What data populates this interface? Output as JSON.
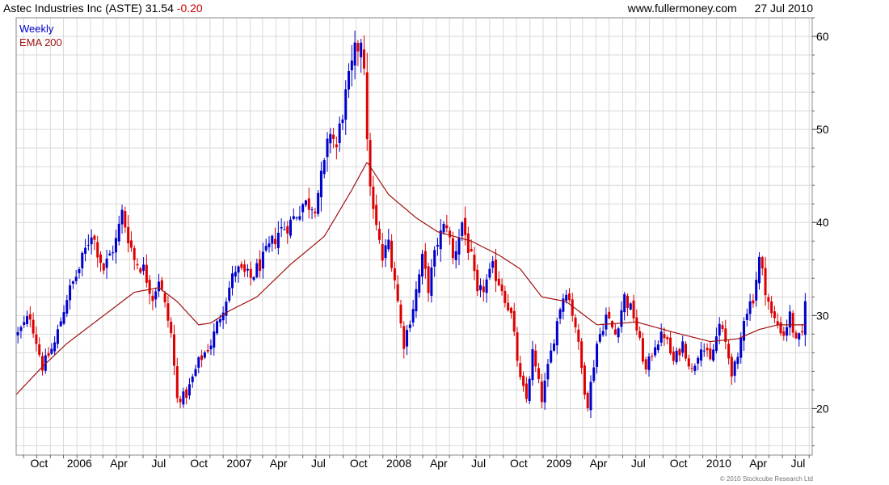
{
  "header": {
    "name": "Astec Industries Inc",
    "ticker": "(ASTE)",
    "last": "31.54",
    "change": "-0.20",
    "website": "www.fullermoney.com",
    "date": "27 Jul 2010"
  },
  "copyright": "© 2010 Stockcube Research Ltd",
  "colors": {
    "up": "#0000cc",
    "down": "#dd0000",
    "ema": "#a01010",
    "grid": "#d9d9d9"
  },
  "chart_data": {
    "type": "candlestick",
    "legend": [
      "Weekly",
      "EMA 200"
    ],
    "legend_colors": [
      "#0000cc",
      "#a01010"
    ],
    "legend_position": "top-left",
    "x_tick_labels": [
      "Oct",
      "2006",
      "Apr",
      "Jul",
      "Oct",
      "2007",
      "Apr",
      "Jul",
      "Oct",
      "2008",
      "Apr",
      "Jul",
      "Oct",
      "2009",
      "Apr",
      "Jul",
      "Oct",
      "2010",
      "Apr",
      "Jul"
    ],
    "x_tick_dates": [
      "2005-10-01",
      "2006-01-01",
      "2006-04-01",
      "2006-07-01",
      "2006-10-01",
      "2007-01-01",
      "2007-04-01",
      "2007-07-01",
      "2007-10-01",
      "2008-01-01",
      "2008-04-01",
      "2008-07-01",
      "2008-10-01",
      "2009-01-01",
      "2009-04-01",
      "2009-07-01",
      "2009-10-01",
      "2010-01-01",
      "2010-04-01",
      "2010-07-01"
    ],
    "x_range": [
      "2005-08-15",
      "2010-08-08"
    ],
    "y_ticks": [
      20,
      30,
      40,
      50,
      60
    ],
    "ylim": [
      15,
      62
    ],
    "y_axis_side": "right",
    "grid": true,
    "close_key_points": [
      [
        "2005-08-19",
        28
      ],
      [
        "2005-09-16",
        30
      ],
      [
        "2005-10-14",
        24.5
      ],
      [
        "2005-11-11",
        27
      ],
      [
        "2005-12-09",
        32
      ],
      [
        "2006-01-06",
        35
      ],
      [
        "2006-02-03",
        39
      ],
      [
        "2006-03-03",
        35
      ],
      [
        "2006-03-31",
        38
      ],
      [
        "2006-04-14",
        41
      ],
      [
        "2006-05-12",
        36
      ],
      [
        "2006-06-02",
        35
      ],
      [
        "2006-06-23",
        32
      ],
      [
        "2006-07-07",
        34
      ],
      [
        "2006-07-21",
        31
      ],
      [
        "2006-08-04",
        28
      ],
      [
        "2006-08-18",
        21
      ],
      [
        "2006-09-08",
        21.5
      ],
      [
        "2006-10-06",
        25
      ],
      [
        "2006-11-03",
        27
      ],
      [
        "2006-12-01",
        31
      ],
      [
        "2006-12-29",
        35
      ],
      [
        "2007-02-02",
        34
      ],
      [
        "2007-03-02",
        36
      ],
      [
        "2007-04-06",
        39
      ],
      [
        "2007-05-04",
        40
      ],
      [
        "2007-06-01",
        42
      ],
      [
        "2007-06-29",
        42
      ],
      [
        "2007-07-20",
        46
      ],
      [
        "2007-08-03",
        50
      ],
      [
        "2007-08-17",
        48
      ],
      [
        "2007-08-31",
        52
      ],
      [
        "2007-09-28",
        58
      ],
      [
        "2007-10-12",
        60
      ],
      [
        "2007-10-19",
        57.5
      ],
      [
        "2007-10-26",
        48
      ],
      [
        "2007-11-09",
        41
      ],
      [
        "2007-11-30",
        36
      ],
      [
        "2007-12-14",
        38
      ],
      [
        "2007-12-28",
        34
      ],
      [
        "2008-01-11",
        29
      ],
      [
        "2008-01-18",
        27
      ],
      [
        "2008-02-08",
        31
      ],
      [
        "2008-02-29",
        36
      ],
      [
        "2008-03-14",
        33
      ],
      [
        "2008-04-04",
        38
      ],
      [
        "2008-04-25",
        40
      ],
      [
        "2008-05-09",
        36
      ],
      [
        "2008-05-30",
        40
      ],
      [
        "2008-06-20",
        36
      ],
      [
        "2008-07-04",
        32
      ],
      [
        "2008-07-18",
        33
      ],
      [
        "2008-08-08",
        35
      ],
      [
        "2008-08-29",
        33
      ],
      [
        "2008-09-19",
        30
      ],
      [
        "2008-10-10",
        23
      ],
      [
        "2008-10-24",
        21
      ],
      [
        "2008-11-07",
        26
      ],
      [
        "2008-11-28",
        21
      ],
      [
        "2008-12-19",
        26
      ],
      [
        "2009-01-09",
        31
      ],
      [
        "2009-01-23",
        33
      ],
      [
        "2009-02-13",
        29
      ],
      [
        "2009-03-06",
        22
      ],
      [
        "2009-03-13",
        20.5
      ],
      [
        "2009-04-03",
        27
      ],
      [
        "2009-04-24",
        30
      ],
      [
        "2009-05-15",
        28
      ],
      [
        "2009-06-05",
        32
      ],
      [
        "2009-06-26",
        30
      ],
      [
        "2009-07-10",
        27
      ],
      [
        "2009-07-24",
        24
      ],
      [
        "2009-08-14",
        27
      ],
      [
        "2009-09-04",
        28
      ],
      [
        "2009-09-25",
        25
      ],
      [
        "2009-10-16",
        27
      ],
      [
        "2009-11-06",
        24
      ],
      [
        "2009-11-27",
        27
      ],
      [
        "2009-12-18",
        25
      ],
      [
        "2010-01-08",
        29
      ],
      [
        "2010-01-22",
        27
      ],
      [
        "2010-02-05",
        24
      ],
      [
        "2010-02-19",
        25
      ],
      [
        "2010-03-05",
        30
      ],
      [
        "2010-03-26",
        32
      ],
      [
        "2010-04-09",
        36
      ],
      [
        "2010-04-23",
        33
      ],
      [
        "2010-05-07",
        30
      ],
      [
        "2010-05-21",
        29
      ],
      [
        "2010-06-04",
        28
      ],
      [
        "2010-06-18",
        30
      ],
      [
        "2010-07-02",
        27
      ],
      [
        "2010-07-16",
        28
      ],
      [
        "2010-07-23",
        31.54
      ]
    ],
    "ema200_key_points": [
      [
        "2005-08-15",
        21.5
      ],
      [
        "2005-10-14",
        24.5
      ],
      [
        "2005-12-09",
        27
      ],
      [
        "2006-03-03",
        30
      ],
      [
        "2006-05-12",
        32.5
      ],
      [
        "2006-07-07",
        33
      ],
      [
        "2006-08-18",
        31.5
      ],
      [
        "2006-10-06",
        29
      ],
      [
        "2006-11-03",
        29.2
      ],
      [
        "2006-12-15",
        30.5
      ],
      [
        "2007-02-16",
        32
      ],
      [
        "2007-05-04",
        35.5
      ],
      [
        "2007-07-20",
        38.5
      ],
      [
        "2007-09-21",
        43.5
      ],
      [
        "2007-10-26",
        46.5
      ],
      [
        "2007-12-14",
        43
      ],
      [
        "2008-02-15",
        40.5
      ],
      [
        "2008-04-04",
        39
      ],
      [
        "2008-06-20",
        38
      ],
      [
        "2008-08-22",
        36.5
      ],
      [
        "2008-10-10",
        35
      ],
      [
        "2008-11-28",
        32
      ],
      [
        "2009-01-23",
        31.5
      ],
      [
        "2009-04-03",
        29
      ],
      [
        "2009-07-03",
        29.3
      ],
      [
        "2009-09-25",
        28.2
      ],
      [
        "2009-12-18",
        27.2
      ],
      [
        "2010-02-19",
        27.5
      ],
      [
        "2010-04-09",
        28.5
      ],
      [
        "2010-05-21",
        29
      ],
      [
        "2010-07-23",
        29
      ]
    ]
  }
}
